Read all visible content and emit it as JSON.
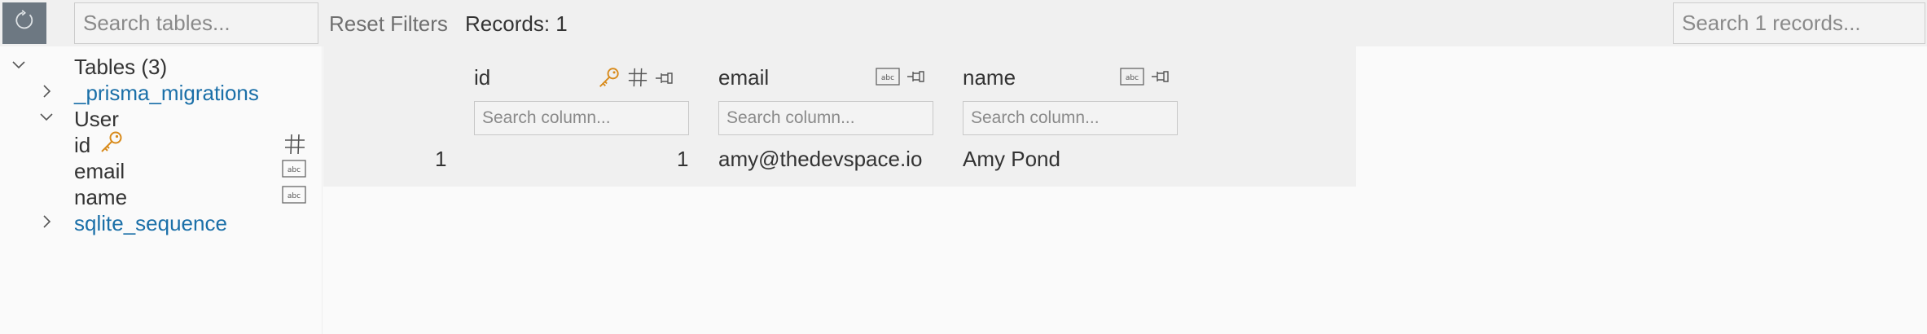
{
  "toolbar": {
    "search_tables_placeholder": "Search tables...",
    "reset_filters_label": "Reset Filters",
    "records_label": "Records: 1",
    "search_records_placeholder": "Search 1 records..."
  },
  "sidebar": {
    "tables_header": "Tables (3)",
    "tables": [
      {
        "name": "_prisma_migrations"
      },
      {
        "name": "User",
        "columns": [
          {
            "name": "id",
            "type_icon": "hash-icon",
            "primary_key": true
          },
          {
            "name": "email",
            "type_icon": "text-type-icon"
          },
          {
            "name": "name",
            "type_icon": "text-type-icon"
          }
        ]
      },
      {
        "name": "sqlite_sequence"
      }
    ]
  },
  "grid": {
    "columns": [
      {
        "header": "id",
        "search_placeholder": "Search column...",
        "icons": [
          "key-icon",
          "hash-icon",
          "pin-icon"
        ]
      },
      {
        "header": "email",
        "search_placeholder": "Search column...",
        "icons": [
          "text-type-icon",
          "pin-icon"
        ]
      },
      {
        "header": "name",
        "search_placeholder": "Search column...",
        "icons": [
          "text-type-icon",
          "pin-icon"
        ]
      }
    ],
    "rows": [
      {
        "row_number": "1",
        "cells": [
          "1",
          "amy@thedevspace.io",
          "Amy Pond"
        ]
      }
    ]
  },
  "colors": {
    "refresh_button_bg": "#6d7882",
    "link_text": "#1a6fa8",
    "key_icon": "#d88a1a",
    "toolbar_bg": "#f0f0f0",
    "page_bg": "#fafafa"
  }
}
